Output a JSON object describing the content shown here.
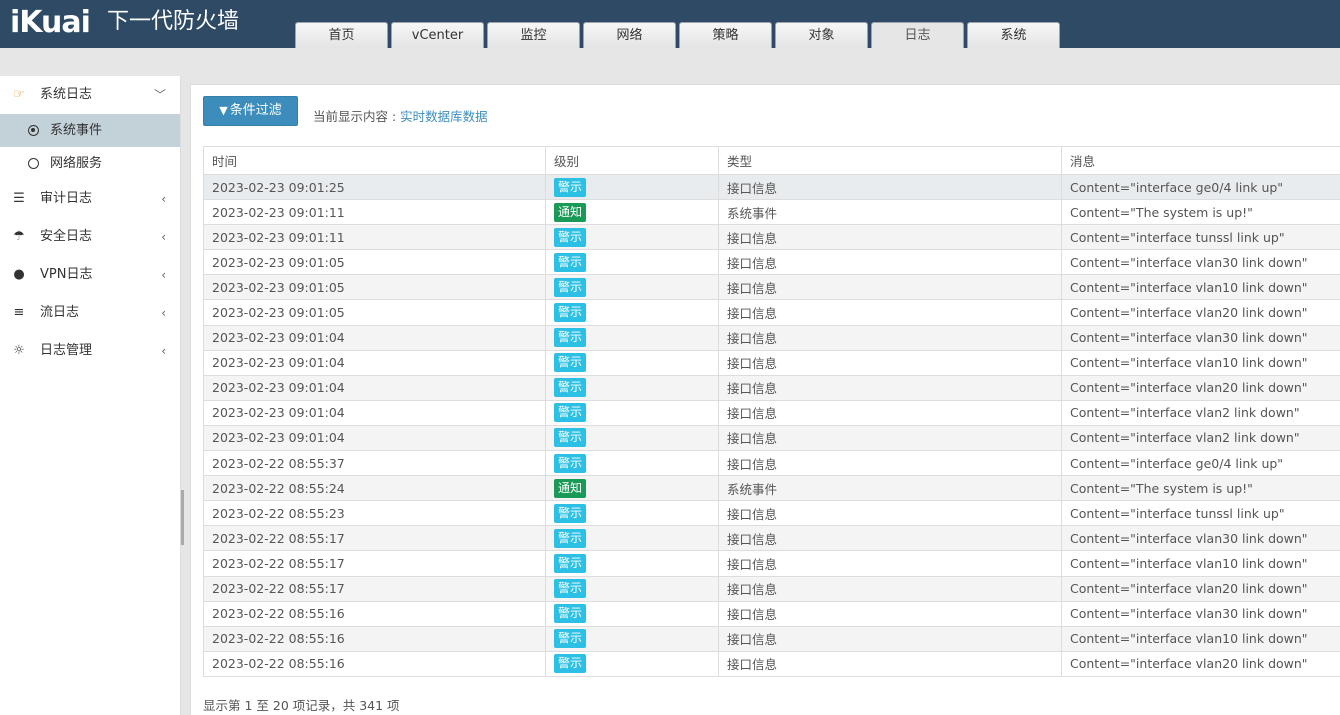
{
  "header": {
    "logo": "iKuai",
    "title": "下一代防火墙",
    "tabs": [
      {
        "label": "首页",
        "active": false
      },
      {
        "label": "vCenter",
        "active": false
      },
      {
        "label": "监控",
        "active": false
      },
      {
        "label": "网络",
        "active": false
      },
      {
        "label": "策略",
        "active": false
      },
      {
        "label": "对象",
        "active": false
      },
      {
        "label": "日志",
        "active": true
      },
      {
        "label": "系统",
        "active": false
      }
    ]
  },
  "sidebar": {
    "system_log": {
      "label": "系统日志",
      "icon": "hand-pointer-icon"
    },
    "sub_items": [
      {
        "label": "系统事件",
        "active": true
      },
      {
        "label": "网络服务",
        "active": false
      }
    ],
    "items": [
      {
        "label": "审计日志",
        "icon": "list-icon"
      },
      {
        "label": "安全日志",
        "icon": "umbrella-icon"
      },
      {
        "label": "VPN日志",
        "icon": "lock-icon"
      },
      {
        "label": "流日志",
        "icon": "sliders-icon"
      },
      {
        "label": "日志管理",
        "icon": "gear-icon"
      }
    ]
  },
  "toolbar": {
    "filter_button": "条件过滤",
    "current_label": "当前显示内容 : ",
    "current_value": "实时数据库数据"
  },
  "table": {
    "columns": [
      "时间",
      "级别",
      "类型",
      "消息"
    ],
    "rows": [
      {
        "time": "2023-02-23 09:01:25",
        "level": "警示",
        "type": "接口信息",
        "msg": "Content=\"interface ge0/4 link up\""
      },
      {
        "time": "2023-02-23 09:01:11",
        "level": "通知",
        "type": "系统事件",
        "msg": "Content=\"The system is up!\""
      },
      {
        "time": "2023-02-23 09:01:11",
        "level": "警示",
        "type": "接口信息",
        "msg": "Content=\"interface tunssl link up\""
      },
      {
        "time": "2023-02-23 09:01:05",
        "level": "警示",
        "type": "接口信息",
        "msg": "Content=\"interface vlan30 link down\""
      },
      {
        "time": "2023-02-23 09:01:05",
        "level": "警示",
        "type": "接口信息",
        "msg": "Content=\"interface vlan10 link down\""
      },
      {
        "time": "2023-02-23 09:01:05",
        "level": "警示",
        "type": "接口信息",
        "msg": "Content=\"interface vlan20 link down\""
      },
      {
        "time": "2023-02-23 09:01:04",
        "level": "警示",
        "type": "接口信息",
        "msg": "Content=\"interface vlan30 link down\""
      },
      {
        "time": "2023-02-23 09:01:04",
        "level": "警示",
        "type": "接口信息",
        "msg": "Content=\"interface vlan10 link down\""
      },
      {
        "time": "2023-02-23 09:01:04",
        "level": "警示",
        "type": "接口信息",
        "msg": "Content=\"interface vlan20 link down\""
      },
      {
        "time": "2023-02-23 09:01:04",
        "level": "警示",
        "type": "接口信息",
        "msg": "Content=\"interface vlan2 link down\""
      },
      {
        "time": "2023-02-23 09:01:04",
        "level": "警示",
        "type": "接口信息",
        "msg": "Content=\"interface vlan2 link down\""
      },
      {
        "time": "2023-02-22 08:55:37",
        "level": "警示",
        "type": "接口信息",
        "msg": "Content=\"interface ge0/4 link up\""
      },
      {
        "time": "2023-02-22 08:55:24",
        "level": "通知",
        "type": "系统事件",
        "msg": "Content=\"The system is up!\""
      },
      {
        "time": "2023-02-22 08:55:23",
        "level": "警示",
        "type": "接口信息",
        "msg": "Content=\"interface tunssl link up\""
      },
      {
        "time": "2023-02-22 08:55:17",
        "level": "警示",
        "type": "接口信息",
        "msg": "Content=\"interface vlan30 link down\""
      },
      {
        "time": "2023-02-22 08:55:17",
        "level": "警示",
        "type": "接口信息",
        "msg": "Content=\"interface vlan10 link down\""
      },
      {
        "time": "2023-02-22 08:55:17",
        "level": "警示",
        "type": "接口信息",
        "msg": "Content=\"interface vlan20 link down\""
      },
      {
        "time": "2023-02-22 08:55:16",
        "level": "警示",
        "type": "接口信息",
        "msg": "Content=\"interface vlan30 link down\""
      },
      {
        "time": "2023-02-22 08:55:16",
        "level": "警示",
        "type": "接口信息",
        "msg": "Content=\"interface vlan10 link down\""
      },
      {
        "time": "2023-02-22 08:55:16",
        "level": "警示",
        "type": "接口信息",
        "msg": "Content=\"interface vlan20 link down\""
      }
    ]
  },
  "footer": {
    "summary": "显示第 1 至 20 项记录，共 341 项"
  },
  "colors": {
    "header_bg": "#2e4a64",
    "primary": "#3c8dbc",
    "warn_badge": "#2bc0e4",
    "notice_badge": "#1a9a57",
    "sidebar_active": "#c3d1d8"
  }
}
